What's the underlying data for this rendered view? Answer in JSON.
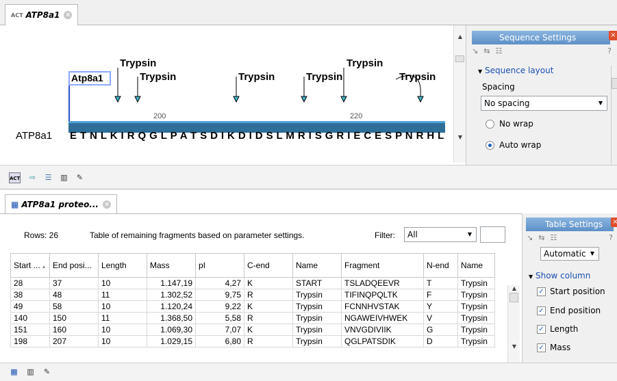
{
  "top_tab": {
    "icon": "ACT",
    "title": "ATP8a1"
  },
  "sequence": {
    "name": "ATP8a1",
    "residues": "E T N L K I R Q G L P A T S D I K D I D S L M R I S G R I E C E S P N R H L",
    "annotation": "Atp8a1",
    "ruler_ticks": [
      "200",
      "220"
    ],
    "enzymes": [
      "Trypsin",
      "Trypsin",
      "Trypsin",
      "Trypsin",
      "Trypsin",
      "Trypsin"
    ]
  },
  "sequence_settings": {
    "title": "Sequence Settings",
    "section": "Sequence layout",
    "spacing_label": "Spacing",
    "spacing_value": "No spacing",
    "radios": [
      {
        "label": "No wrap",
        "checked": false
      },
      {
        "label": "Auto wrap",
        "checked": true
      }
    ],
    "help": "?"
  },
  "table_tab": {
    "title": "ATP8a1 proteo..."
  },
  "table": {
    "rows_label": "Rows: 26",
    "description": "Table of remaining fragments based on parameter settings.",
    "filter_label": "Filter:",
    "filter_value": "All",
    "filter_text": "",
    "columns": [
      "Start ...",
      "End posi...",
      "Length",
      "Mass",
      "pI",
      "C-end",
      "Name",
      "Fragment",
      "N-end",
      "Name"
    ],
    "rows": [
      [
        "28",
        "37",
        "10",
        "1.147,19",
        "4,27",
        "K",
        "START",
        "TSLADQEEVR",
        "T",
        "Trypsin"
      ],
      [
        "38",
        "48",
        "11",
        "1.302,52",
        "9,75",
        "R",
        "Trypsin",
        "TIFINQPQLTK",
        "F",
        "Trypsin"
      ],
      [
        "49",
        "58",
        "10",
        "1.120,24",
        "9,22",
        "K",
        "Trypsin",
        "FCNNHVSTAK",
        "Y",
        "Trypsin"
      ],
      [
        "140",
        "150",
        "11",
        "1.368,50",
        "5,58",
        "R",
        "Trypsin",
        "NGAWEIVHWEK",
        "V",
        "Trypsin"
      ],
      [
        "151",
        "160",
        "10",
        "1.069,30",
        "7,07",
        "K",
        "Trypsin",
        "VNVGDIVIIK",
        "G",
        "Trypsin"
      ],
      [
        "198",
        "207",
        "10",
        "1.029,15",
        "6,80",
        "R",
        "Trypsin",
        "QGLPATSDIK",
        "D",
        "Trypsin"
      ]
    ]
  },
  "table_settings": {
    "title": "Table Settings",
    "mode": "Automatic",
    "section": "Show column",
    "columns": [
      {
        "label": "Start position",
        "checked": true
      },
      {
        "label": "End position",
        "checked": true
      },
      {
        "label": "Length",
        "checked": true
      },
      {
        "label": "Mass",
        "checked": true
      }
    ],
    "help": "?"
  }
}
